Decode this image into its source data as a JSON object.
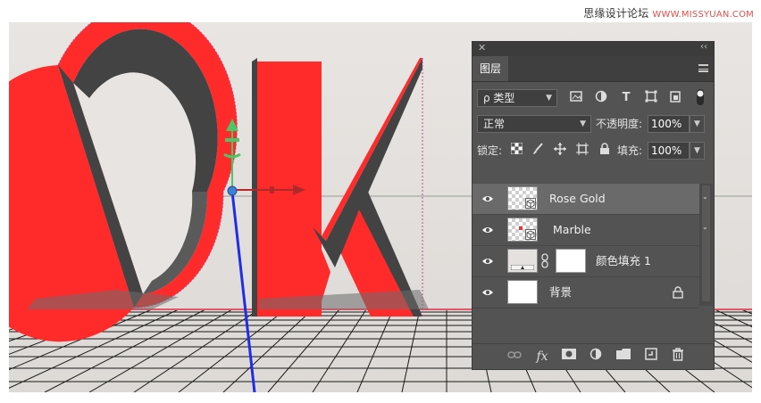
{
  "watermark": {
    "site_name": "思缘设计论坛",
    "site_url": "WWW.MISSYUAN.COM"
  },
  "panel": {
    "close_glyph": "✕",
    "collapse_glyph": "‹‹",
    "tab_label": "图层",
    "filter_kind": "ρ 类型",
    "blend_mode": "正常",
    "opacity_label": "不透明度:",
    "opacity_value": "100%",
    "lock_label": "锁定:",
    "fill_label": "填充:",
    "fill_value": "100%",
    "layers": [
      {
        "name": "Rose Gold",
        "selected": true,
        "thumb": "smart-object"
      },
      {
        "name": "Marble",
        "selected": false,
        "thumb": "smart-object"
      },
      {
        "name": "颜色填充 1",
        "selected": false,
        "thumb": "fill-layer"
      },
      {
        "name": "背景",
        "selected": false,
        "thumb": "background"
      }
    ],
    "bottom_icons": [
      "link-icon",
      "fx-icon",
      "mask-icon",
      "adjustment-icon",
      "folder-icon",
      "new-layer-icon",
      "trash-icon"
    ],
    "fx_label": "fx"
  },
  "colors": {
    "letter_red": "#ff2b2b",
    "letter_side": "#434343",
    "panel_bg": "#535353",
    "selected_row": "#6a6a6a",
    "gizmo_green": "#4cc766",
    "gizmo_red": "#b02a2a",
    "gizmo_blue": "#1f2ee6"
  }
}
